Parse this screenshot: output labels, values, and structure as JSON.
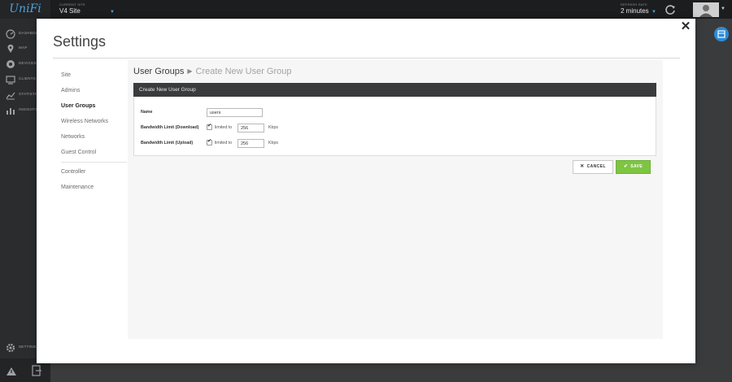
{
  "brand": {
    "logo_text": "UniFi"
  },
  "topbar": {
    "current_site_caption": "CURRENT SITE",
    "site_name": "V4 Site",
    "refresh_caption": "REFRESH RATE",
    "refresh_value": "2 minutes"
  },
  "sidenav": {
    "items": [
      {
        "label": "DASHBOARD",
        "icon": "dashboard-icon"
      },
      {
        "label": "MAP",
        "icon": "map-pin-icon"
      },
      {
        "label": "DEVICES",
        "icon": "devices-icon"
      },
      {
        "label": "CLIENTS",
        "icon": "monitor-icon"
      },
      {
        "label": "STATISTICS",
        "icon": "line-chart-icon"
      },
      {
        "label": "INSIGHTS",
        "icon": "bar-chart-icon"
      }
    ],
    "settings_label": "SETTINGS"
  },
  "modal": {
    "title": "Settings",
    "nav": {
      "items": [
        "Site",
        "Admins",
        "User Groups",
        "Wireless Networks",
        "Networks",
        "Guest Control"
      ],
      "active": "User Groups",
      "secondary": [
        "Controller",
        "Maintenance"
      ]
    },
    "breadcrumb": {
      "root": "User Groups",
      "current": "Create New User Group"
    },
    "form": {
      "header": "Create New User Group",
      "name_label": "Name",
      "name_value": "users",
      "download_label": "Bandwidth Limit (Download)",
      "download_checkbox_label": "limited to",
      "download_value": "256",
      "download_unit": "Kbps",
      "upload_label": "Bandwidth Limit (Upload)",
      "upload_checkbox_label": "limited to",
      "upload_value": "256",
      "upload_unit": "Kbps"
    },
    "buttons": {
      "cancel": "CANCEL",
      "save": "SAVE"
    }
  },
  "colors": {
    "accent": "#4aa3df",
    "save_green": "#7ec542",
    "header_dark": "#3a3b3d"
  }
}
